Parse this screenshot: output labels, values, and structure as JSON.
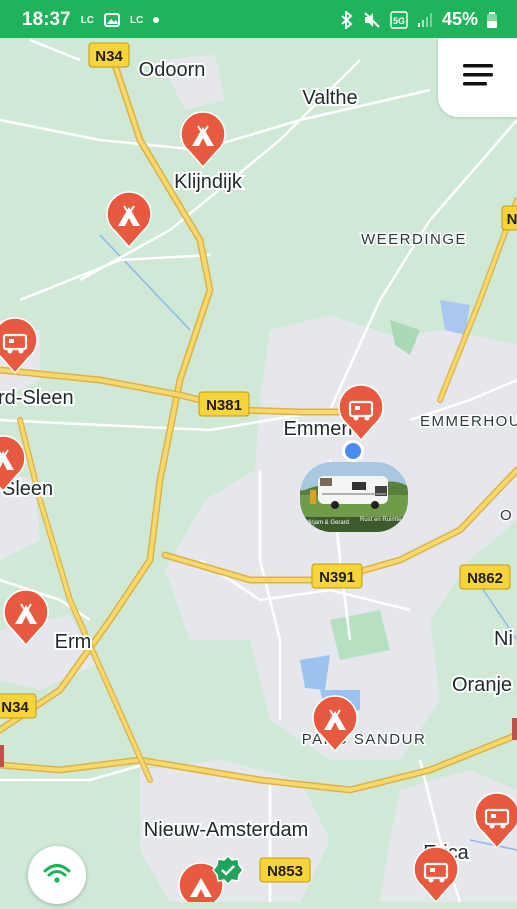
{
  "status_bar": {
    "time": "18:37",
    "notif1": "LC",
    "notif3": "LC",
    "battery": "45%",
    "signal": "5G"
  },
  "map": {
    "places": {
      "odoorn": "Odoorn",
      "valthe": "Valthe",
      "klijndijk": "Klijndijk",
      "weerdinge": "WEERDINGE",
      "sleen1": "rd-Sleen",
      "emmen": "Emmen",
      "emmerhout": "EMMERHOU",
      "sleen2": "Sleen",
      "o_partial": "O",
      "erm": "Erm",
      "ni_partial": "Ni",
      "oranje_partial": "Oranje",
      "parc_sandur": "PARC SANDUR",
      "nieuw_amsterdam": "Nieuw-Amsterdam",
      "erica": "Erica"
    },
    "roads": {
      "n34_top": "N34",
      "n381": "N381",
      "n391": "N391",
      "n862": "N862",
      "n34_left": "N34",
      "n853": "N853",
      "n_right": "N"
    },
    "thumbnail_caption_left": "Mirjam & Gerard",
    "thumbnail_caption_right": "Rust en Ruimte"
  },
  "icons": {
    "menu": "hamburger-menu-icon",
    "wifi": "wifi-icon",
    "campsite": "tent-icon",
    "camper": "camper-icon",
    "location": "current-location-dot",
    "verified": "verified-badge-icon"
  },
  "colors": {
    "accent": "#1fb35b",
    "marker": "#e85a3f",
    "map_green": "#cfe9d6",
    "road_yellow": "#f2c94c"
  }
}
